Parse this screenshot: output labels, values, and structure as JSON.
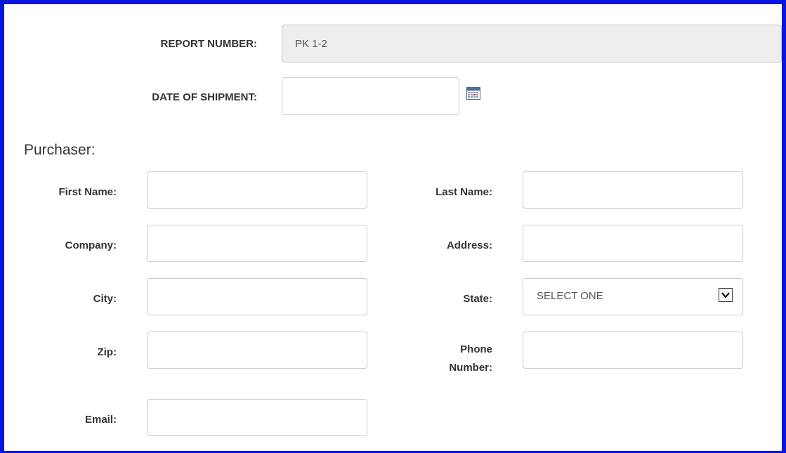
{
  "report": {
    "number_label": "REPORT NUMBER:",
    "number_value": "PK 1-2"
  },
  "shipment": {
    "date_label": "DATE OF SHIPMENT:",
    "date_value": ""
  },
  "purchaser": {
    "section_title": "Purchaser:",
    "first_name_label": "First Name:",
    "first_name_value": "",
    "last_name_label": "Last Name:",
    "last_name_value": "",
    "company_label": "Company:",
    "company_value": "",
    "address_label": "Address:",
    "address_value": "",
    "city_label": "City:",
    "city_value": "",
    "state_label": "State:",
    "state_selected": "SELECT ONE",
    "zip_label": "Zip:",
    "zip_value": "",
    "phone_label_line1": "Phone",
    "phone_label_line2": "Number:",
    "phone_value": "",
    "email_label": "Email:",
    "email_value": ""
  },
  "icons": {
    "calendar": "calendar-icon",
    "dropdown": "chevron-down-icon"
  },
  "colors": {
    "frame_border": "#0a14e0",
    "readonly_bg": "#eeeeee",
    "input_border": "#cccccc",
    "label_text": "#333333"
  }
}
